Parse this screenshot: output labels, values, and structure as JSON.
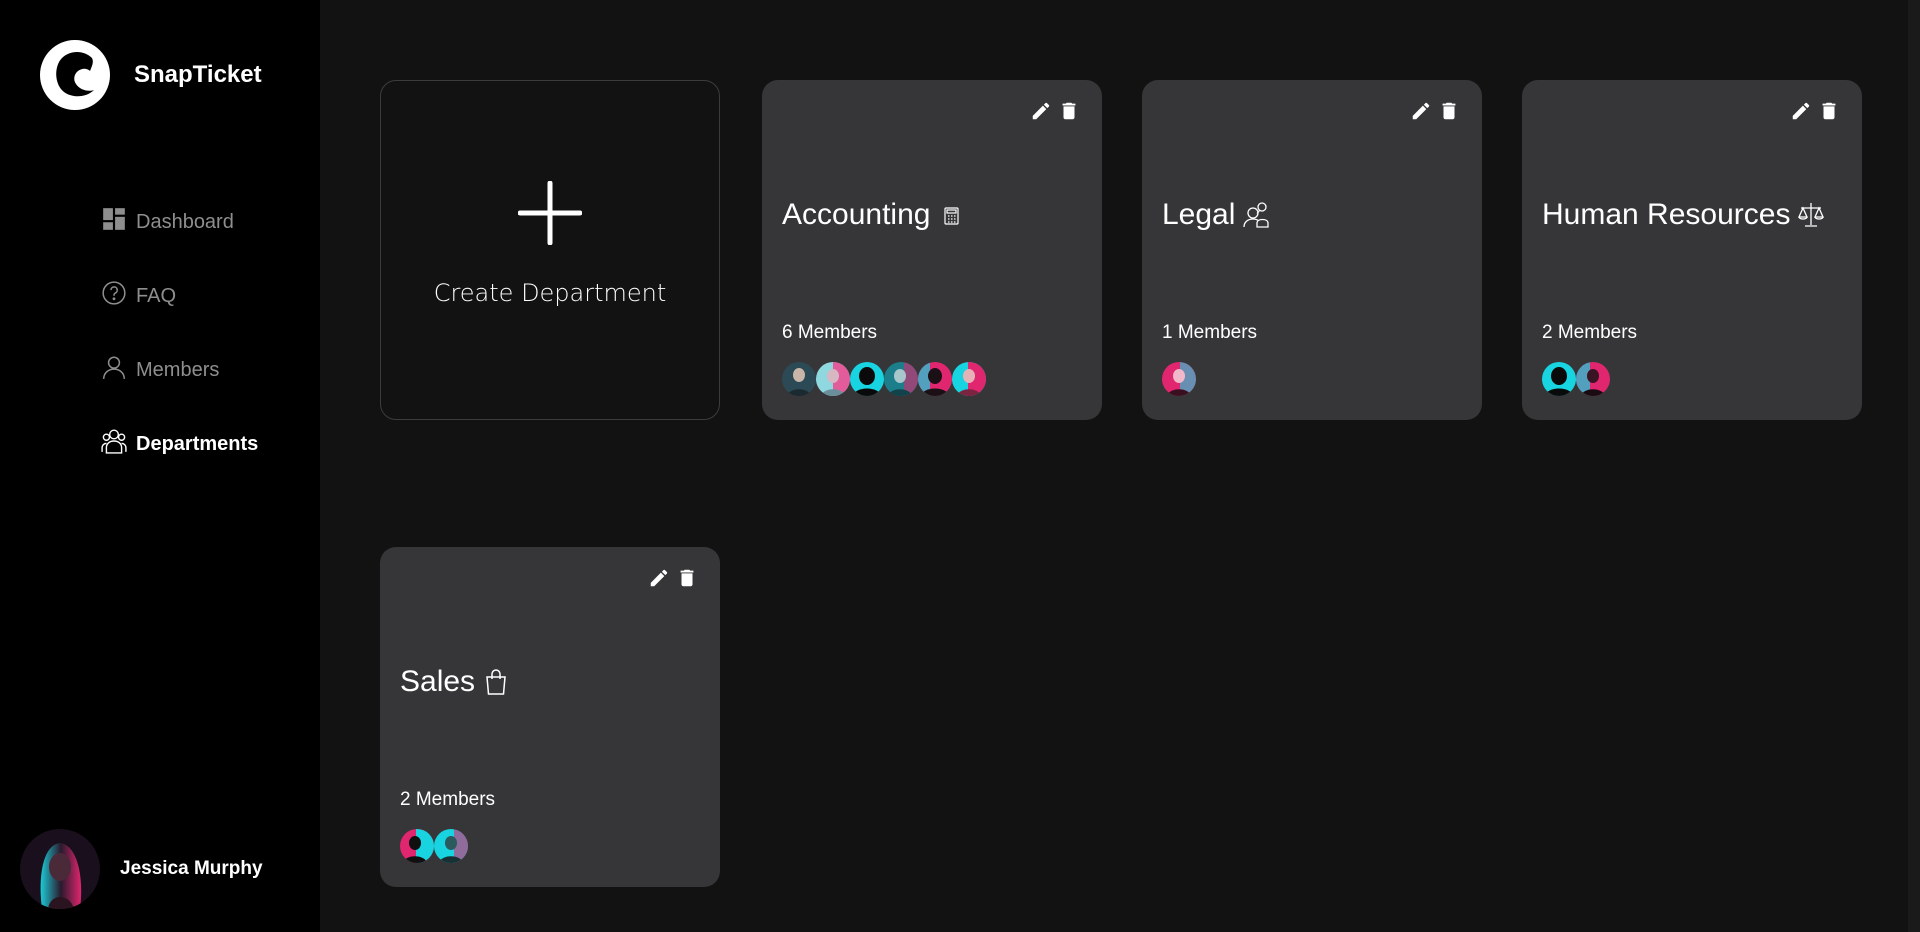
{
  "app": {
    "name": "SnapTicket"
  },
  "nav": {
    "items": [
      {
        "label": "Dashboard",
        "icon": "dashboard-icon"
      },
      {
        "label": "FAQ",
        "icon": "question-circle-icon"
      },
      {
        "label": "Members",
        "icon": "person-icon"
      },
      {
        "label": "Departments",
        "icon": "people-group-icon",
        "active": true
      }
    ]
  },
  "user": {
    "name": "Jessica Murphy"
  },
  "create": {
    "label": "Create Department"
  },
  "departments": [
    {
      "name": "Accounting",
      "icon": "calculator-icon",
      "members_label": "6 Members",
      "avatar_count": 6
    },
    {
      "name": "Legal",
      "icon": "person-search-icon",
      "members_label": "1 Members",
      "avatar_count": 1
    },
    {
      "name": "Human Resources",
      "icon": "scales-icon",
      "members_label": "2 Members",
      "avatar_count": 2
    },
    {
      "name": "Sales",
      "icon": "shopping-bag-icon",
      "members_label": "2 Members",
      "avatar_count": 2
    }
  ],
  "colors": {
    "sidebar_bg": "#000000",
    "main_bg": "#121212",
    "card_bg": "#363638",
    "nav_inactive": "#8e8e8e",
    "avatar_cyan": "#17d4e0",
    "avatar_pink": "#e0266e"
  }
}
